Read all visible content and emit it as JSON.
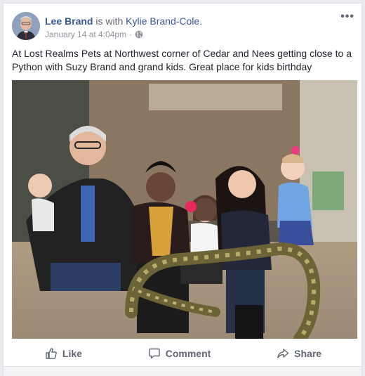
{
  "post": {
    "author": "Lee Brand",
    "with_text": " is with ",
    "tagged": "Kylie Brand-Cole",
    "tagged_suffix": ".",
    "date": "January 14 at 4:04pm",
    "separator": "·",
    "privacy_icon": "globe-icon",
    "more_icon": "ellipsis-icon",
    "text": "At Lost Realms Pets at Northwest corner of Cedar and Nees getting close to a Python with Suzy Brand and grand kids. Great place for kids birthday"
  },
  "actions": {
    "like_label": "Like",
    "comment_label": "Comment",
    "share_label": "Share"
  },
  "colors": {
    "link": "#365899",
    "meta": "#90949c",
    "action": "#606770",
    "background": "#e9ebee"
  }
}
